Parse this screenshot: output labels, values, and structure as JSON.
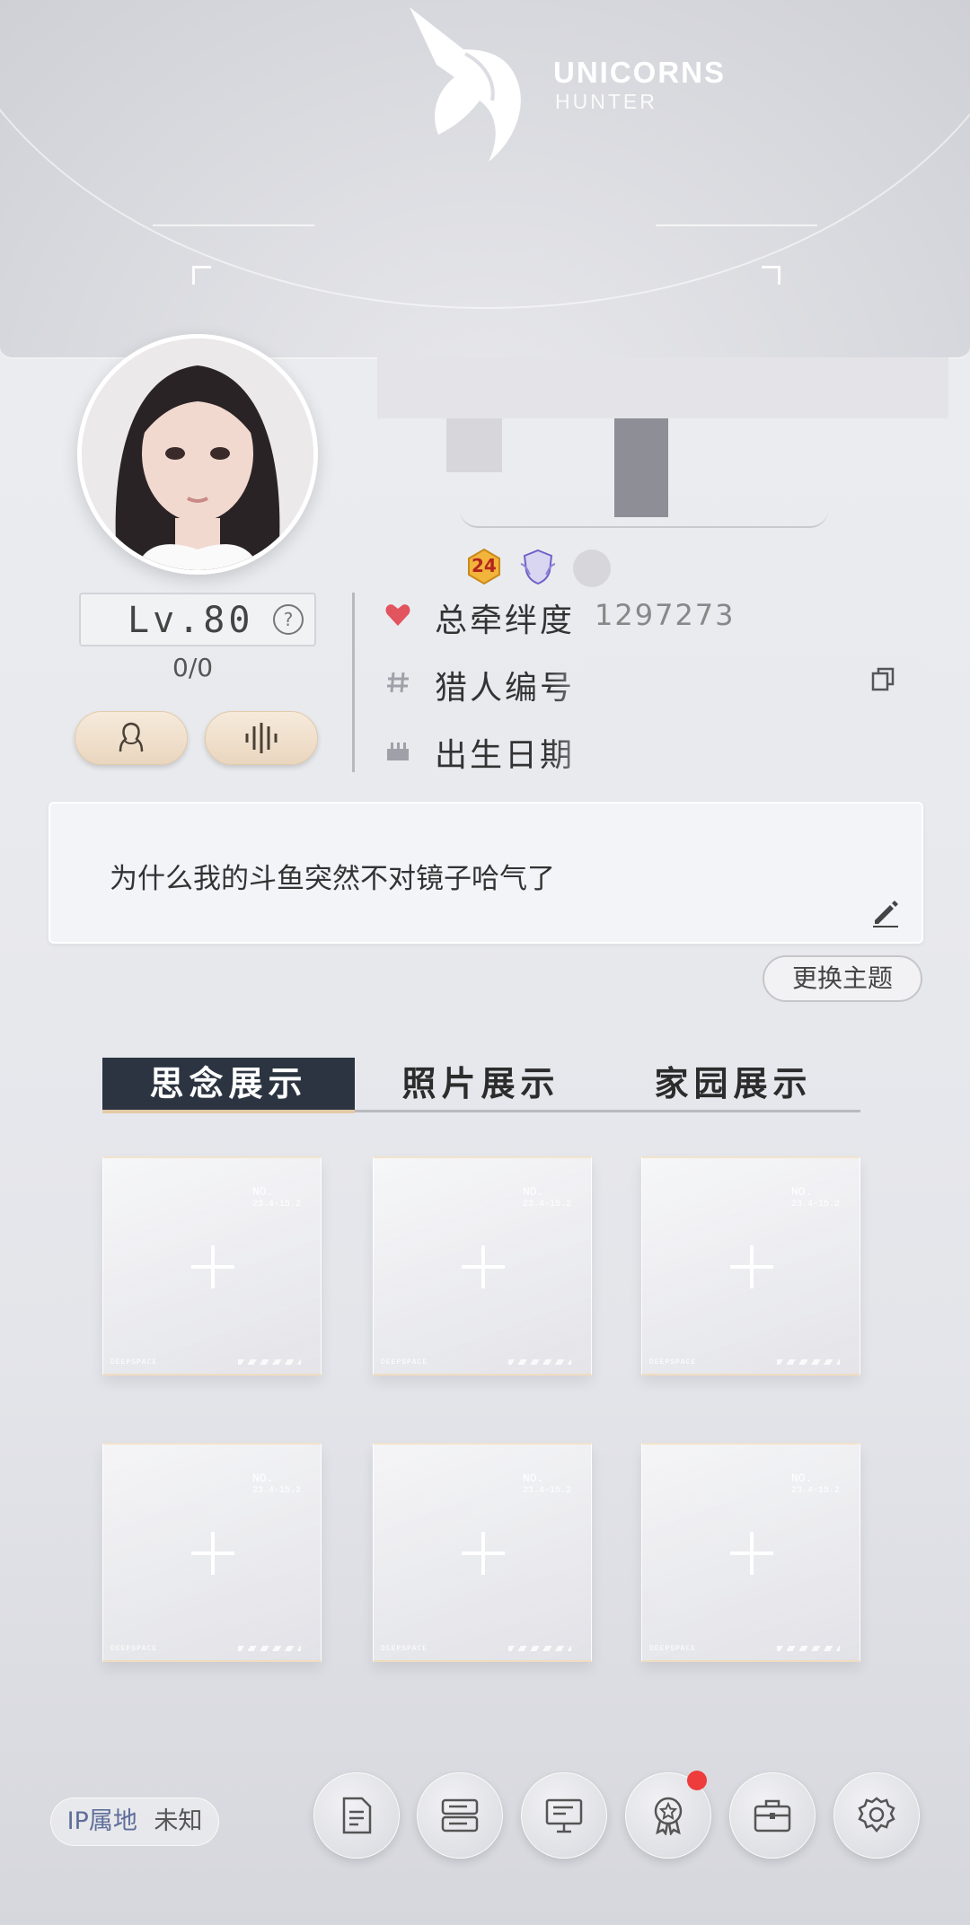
{
  "brand": {
    "title": "UNICORNS",
    "subtitle": "HUNTER"
  },
  "profile": {
    "level": "Lv.80",
    "exp": "0/0",
    "badges": [
      "24"
    ]
  },
  "stats": {
    "bond": {
      "label": "总牵绊度",
      "value": "1297273"
    },
    "hunter_id": {
      "label": "猎人编号"
    },
    "birthday": {
      "label": "出生日期"
    }
  },
  "signature": "为什么我的斗鱼突然不对镜子哈气了",
  "theme_button": "更换主题",
  "tabs": [
    {
      "label": "思念展示",
      "active": true
    },
    {
      "label": "照片展示",
      "active": false
    },
    {
      "label": "家园展示",
      "active": false
    }
  ],
  "slots": [
    {
      "no": "NO.",
      "code": "23.4-15.2",
      "footer": "DEEPSPACE"
    },
    {
      "no": "NO.",
      "code": "23.4-15.2",
      "footer": "DEEPSPACE"
    },
    {
      "no": "NO.",
      "code": "23.4-15.2",
      "footer": "DEEPSPACE"
    },
    {
      "no": "NO.",
      "code": "23.4-15.2",
      "footer": "DEEPSPACE"
    },
    {
      "no": "NO.",
      "code": "23.4-15.2",
      "footer": "DEEPSPACE"
    },
    {
      "no": "NO.",
      "code": "23.4-15.2",
      "footer": "DEEPSPACE"
    }
  ],
  "ip": {
    "label": "IP属地",
    "value": "未知"
  },
  "nav_icons": [
    "document-icon",
    "server-icon",
    "monitor-icon",
    "award-icon",
    "briefcase-icon",
    "settings-icon"
  ],
  "colors": {
    "accent_dark": "#2b3440",
    "tab_underline": "#e2c9a6",
    "notification": "#ee3b3b",
    "heart": "#e2545e"
  }
}
